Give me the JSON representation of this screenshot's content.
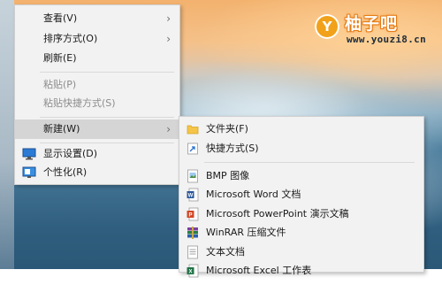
{
  "watermark": {
    "logo_letter": "Y",
    "name": "柚子吧",
    "url": "www.youzi8.cn"
  },
  "context_menu": {
    "items": [
      {
        "label": "查看(V)",
        "has_submenu": true,
        "enabled": true
      },
      {
        "label": "排序方式(O)",
        "has_submenu": true,
        "enabled": true
      },
      {
        "label": "刷新(E)",
        "has_submenu": false,
        "enabled": true
      },
      {
        "label": "粘贴(P)",
        "has_submenu": false,
        "enabled": false
      },
      {
        "label": "粘贴快捷方式(S)",
        "has_submenu": false,
        "enabled": false
      },
      {
        "label": "新建(W)",
        "has_submenu": true,
        "enabled": true,
        "highlighted": true
      },
      {
        "label": "显示设置(D)",
        "icon": "display-icon",
        "enabled": true
      },
      {
        "label": "个性化(R)",
        "icon": "personalize-icon",
        "enabled": true
      }
    ]
  },
  "new_submenu": {
    "items": [
      {
        "label": "文件夹(F)",
        "icon": "folder-icon"
      },
      {
        "label": "快捷方式(S)",
        "icon": "shortcut-icon"
      },
      {
        "label": "BMP 图像",
        "icon": "bmp-image-icon"
      },
      {
        "label": "Microsoft Word 文档",
        "icon": "word-doc-icon"
      },
      {
        "label": "Microsoft PowerPoint 演示文稿",
        "icon": "powerpoint-icon"
      },
      {
        "label": "WinRAR 压缩文件",
        "icon": "winrar-icon"
      },
      {
        "label": "文本文档",
        "icon": "text-doc-icon"
      },
      {
        "label": "Microsoft Excel 工作表",
        "icon": "excel-icon"
      }
    ]
  },
  "colors": {
    "menu_bg": "#f2f2f2",
    "highlight": "#d5d5d5",
    "disabled_text": "#8c8c8c",
    "logo_orange": "#f1a11a"
  }
}
